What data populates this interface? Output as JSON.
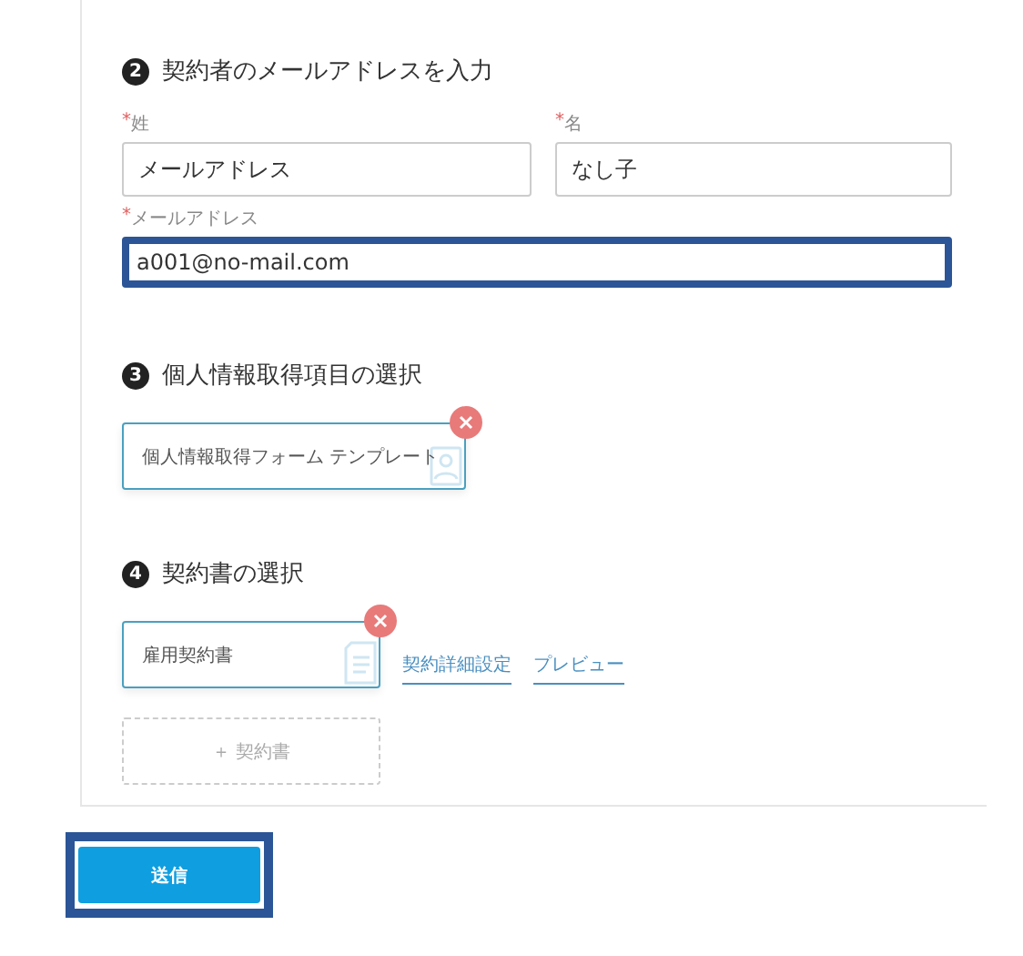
{
  "sections": [
    {
      "number": "2",
      "title": "契約者のメールアドレスを入力",
      "kind": "fields",
      "fields": [
        {
          "required_mark": "*",
          "label": "姓",
          "value": "メールアドレス",
          "highlighted": false
        },
        {
          "required_mark": "*",
          "label": "名",
          "value": "なし子",
          "highlighted": false
        },
        {
          "required_mark": "*",
          "label": "メールアドレス",
          "value": "a001@no-mail.com",
          "highlighted": true
        }
      ]
    },
    {
      "number": "3",
      "title": "個人情報取得項目の選択",
      "kind": "chips",
      "chips": [
        {
          "label": "個人情報取得フォーム テンプレート"
        }
      ]
    },
    {
      "number": "4",
      "title": "契約書の選択",
      "kind": "chips",
      "chips": [
        {
          "label": "雇用契約書"
        }
      ],
      "links": [
        "契約詳細設定",
        "プレビュー"
      ],
      "add_label": "＋ 契約書"
    }
  ],
  "submit": {
    "label": "送信",
    "highlighted": true
  }
}
